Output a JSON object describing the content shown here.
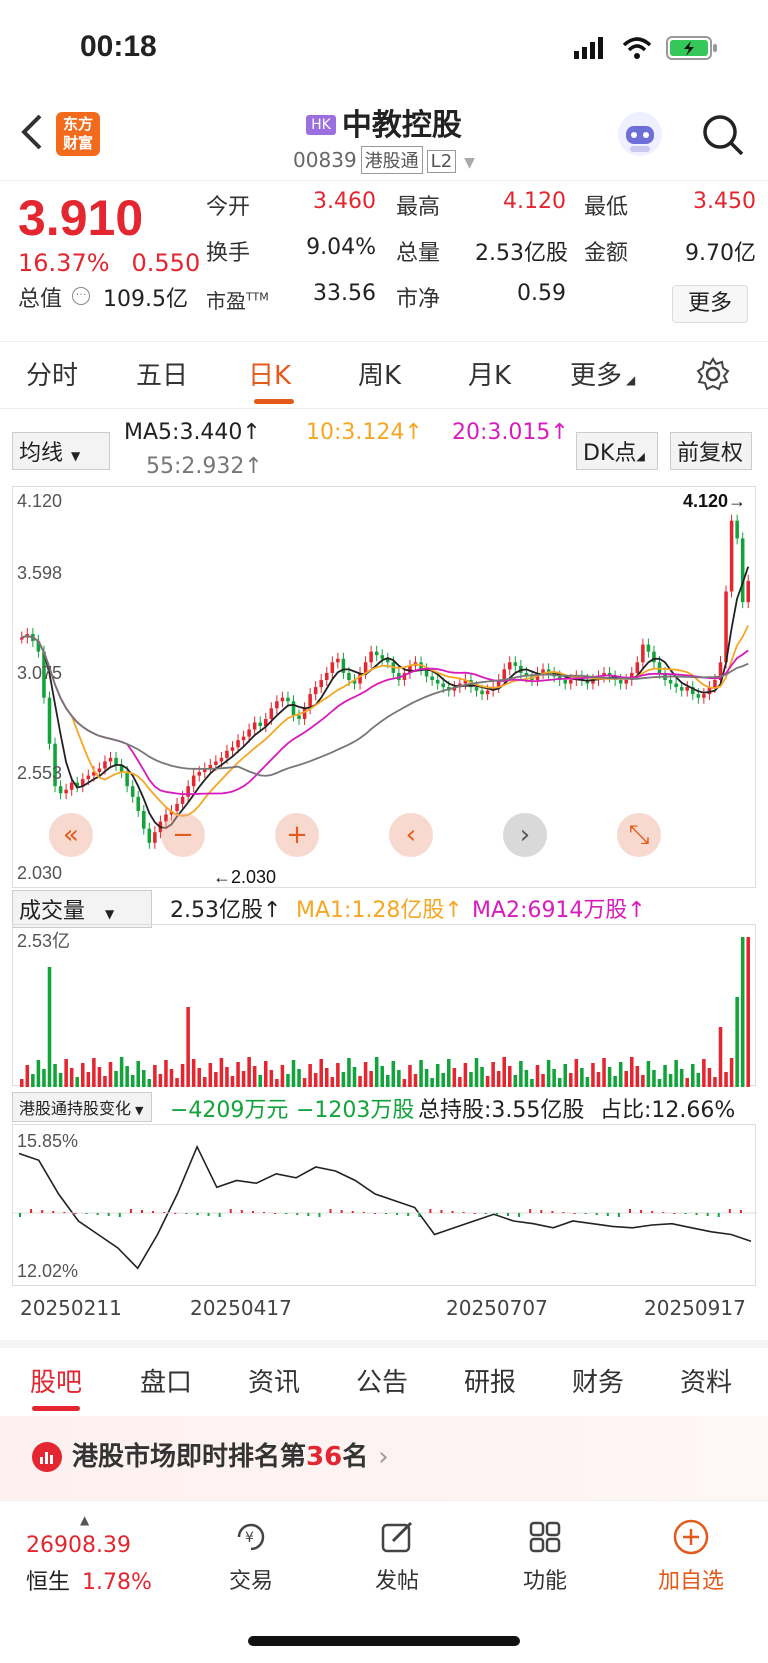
{
  "status": {
    "time": "00:18"
  },
  "nav": {
    "brand_line1": "东方",
    "brand_line2": "财富",
    "hk_badge": "HK",
    "title": "中教控股",
    "code": "00839",
    "tag1": "港股通",
    "tag2": "L2"
  },
  "quote": {
    "price": "3.910",
    "change_pct": "16.37%",
    "change_amt": "0.550",
    "open_label": "今开",
    "open": "3.460",
    "high_label": "最高",
    "high": "4.120",
    "low_label": "最低",
    "low": "3.450",
    "turnover_label": "换手",
    "turnover": "9.04%",
    "volume_label": "总量",
    "volume": "2.53亿股",
    "amount_label": "金额",
    "amount": "9.70亿",
    "mktcap_label": "总值",
    "mktcap": "109.5亿",
    "pe_label": "市盈",
    "pe_sup": "TTM",
    "pe": "33.56",
    "pb_label": "市净",
    "pb": "0.59",
    "more": "更多"
  },
  "ktabs": [
    "分时",
    "五日",
    "日K",
    "周K",
    "月K",
    "更多"
  ],
  "ma": {
    "selector": "均线",
    "ma5": "MA5:3.440↑",
    "ma10": "10:3.124↑",
    "ma20": "20:3.015↑",
    "ma55": "55:2.932↑",
    "dk": "DK点",
    "fq": "前复权"
  },
  "chart_axes": {
    "y_top": "4.120",
    "y_2": "3.598",
    "y_3": "3.075",
    "y_4": "2.553",
    "y_bottom": "2.030",
    "max_marker": "4.120",
    "min_marker": "2.030"
  },
  "volume": {
    "selector": "成交量",
    "value": "2.53亿股↑",
    "ma1": "MA1:1.28亿股↑",
    "ma2": "MA2:6914万股↑",
    "y_top": "2.53亿"
  },
  "holding": {
    "selector": "港股通持股变化",
    "chg1": "−4209万元",
    "chg2": "−1203万股",
    "total": "总持股:3.55亿股",
    "ratio": "占比:12.66%",
    "y_top": "15.85%",
    "y_bottom": "12.02%"
  },
  "dates": [
    "20250211",
    "20250417",
    "20250707",
    "20250917"
  ],
  "bottom_tabs": [
    "股吧",
    "盘口",
    "资讯",
    "公告",
    "研报",
    "财务",
    "资料"
  ],
  "rank": {
    "prefix": "港股市场即时排名第",
    "num": "36",
    "suffix": "名"
  },
  "dock": {
    "index_value": "26908.39",
    "index_name": "恒生",
    "index_pct": "1.78%",
    "trade": "交易",
    "post": "发帖",
    "func": "功能",
    "watch": "加自选"
  },
  "colors": {
    "up": "#e3262f",
    "down": "#12a33a",
    "accent": "#e35a1a",
    "ma10": "#f5a623",
    "ma20": "#d81bbd",
    "ma55": "#777777"
  }
}
